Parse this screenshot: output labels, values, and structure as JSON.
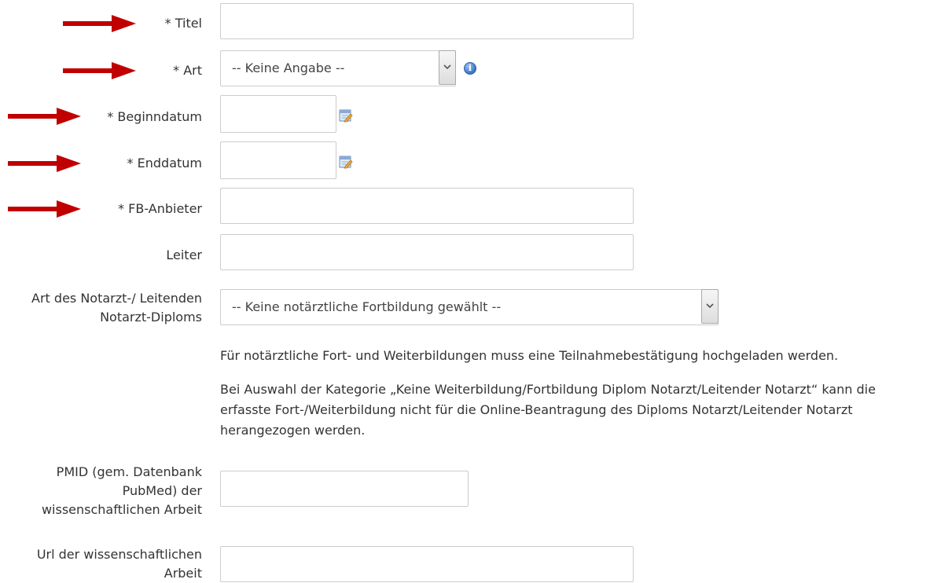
{
  "fields": {
    "titel": {
      "label": "* Titel",
      "value": ""
    },
    "art": {
      "label": "* Art",
      "selected": "-- Keine Angabe --"
    },
    "beginndatum": {
      "label": "* Beginndatum",
      "value": ""
    },
    "enddatum": {
      "label": "* Enddatum",
      "value": ""
    },
    "fb_anbieter": {
      "label": "* FB-Anbieter",
      "value": ""
    },
    "leiter": {
      "label": "Leiter",
      "value": ""
    },
    "diplom_art": {
      "label": "Art des Notarzt-/ Leitenden\nNotarzt-Diploms",
      "selected": "-- Keine notärztliche Fortbildung gewählt --"
    },
    "pmid": {
      "label": "PMID (gem. Datenbank\nPubMed) der\nwissenschaftlichen Arbeit",
      "value": ""
    },
    "url": {
      "label": "Url der wissenschaftlichen\nArbeit",
      "value": ""
    }
  },
  "info": {
    "upload_notice": "Für notärztliche Fort- und Weiterbildungen muss eine Teilnahmebestätigung hochgeladen werden.",
    "category_notice": "Bei Auswahl der Kategorie „Keine Weiterbildung/Fortbildung Diplom Notarzt/Leitender Notarzt“ kann die erfasste Fort-/Weiterbildung nicht für die Online-Beantragung des Diploms Notarzt/Leitender Notarzt herangezogen werden."
  },
  "icons": {
    "arrow": "red-arrow-icon",
    "calendar": "calendar-icon",
    "info": "info-icon",
    "dropdown": "chevron-down-icon"
  },
  "colors": {
    "arrow": "#c00000",
    "info_icon": "#3c74c4",
    "border": "#cccccc"
  }
}
